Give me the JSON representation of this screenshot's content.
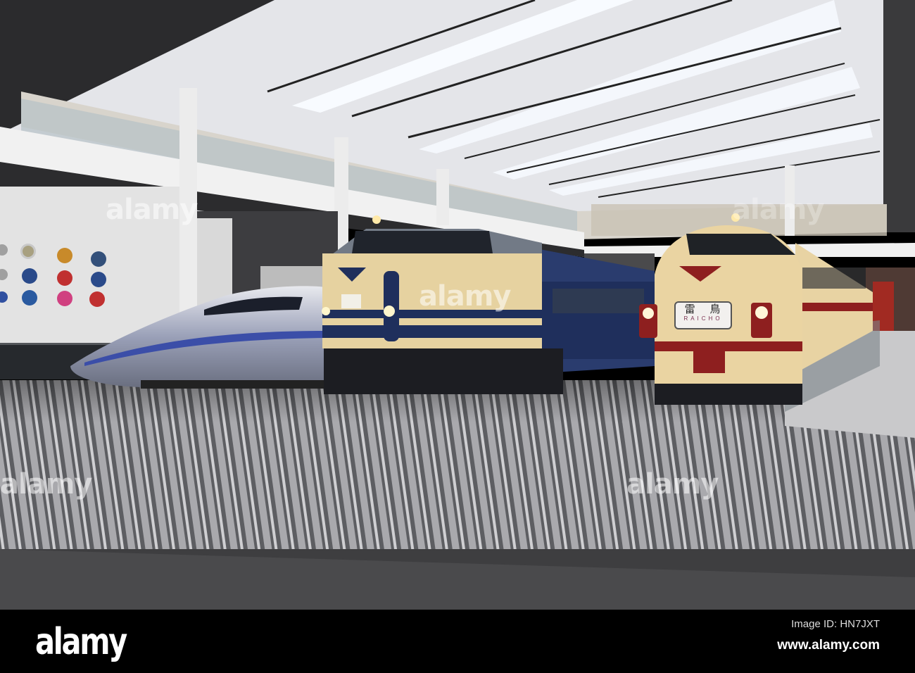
{
  "photo": {
    "subject": "Railway museum hall with three trains",
    "headboard": {
      "kanji": "雷 鳥",
      "roman": "RAICHO"
    },
    "watermarks": [
      "alamy",
      "alamy",
      "alamy",
      "alamy",
      "alamy"
    ]
  },
  "footer": {
    "logo": "alamy",
    "image_id": "Image ID: HN7JXT",
    "website": "www.alamy.com"
  },
  "colors": {
    "cream": "#e9d3a4",
    "navy": "#1f2f5c",
    "red": "#8e1f1f",
    "ceiling": "#e6e7ea",
    "floor": "#6e6f73"
  }
}
